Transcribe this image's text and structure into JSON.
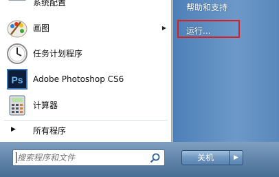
{
  "start_menu": {
    "programs": [
      {
        "label": "系统配置",
        "icon": "system-config-icon",
        "partial": true
      },
      {
        "label": "画图",
        "icon": "paint-icon",
        "has_submenu": true
      },
      {
        "label": "任务计划程序",
        "icon": "task-scheduler-icon"
      },
      {
        "label": "Adobe Photoshop CS6",
        "icon": "photoshop-icon",
        "icon_text": "Ps"
      },
      {
        "label": "计算器",
        "icon": "calculator-icon"
      }
    ],
    "all_programs_label": "所有程序",
    "search": {
      "placeholder": "搜索程序和文件",
      "value": ""
    },
    "right_items": [
      {
        "label": "帮助和支持"
      },
      {
        "label": "运行..."
      }
    ],
    "shutdown_label": "关机",
    "colors": {
      "highlight_border": "#d91f1f",
      "right_panel": "#5a88bd"
    }
  }
}
